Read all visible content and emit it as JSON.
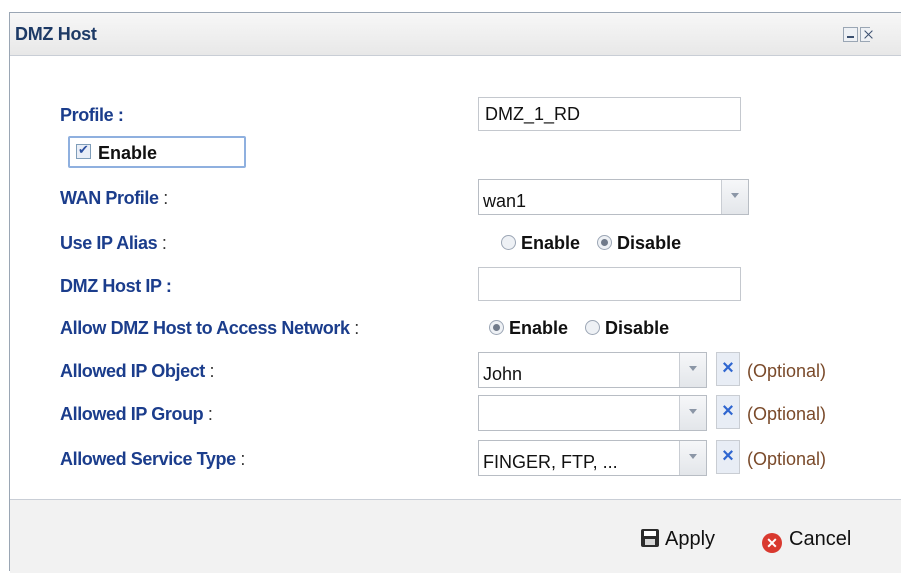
{
  "window": {
    "title": "DMZ Host",
    "minimize_icon": "minimize-icon",
    "close_icon": "close-icon"
  },
  "form": {
    "profile": {
      "label": "Profile :",
      "value": "DMZ_1_RD"
    },
    "enable": {
      "label": "Enable",
      "checked": true
    },
    "wan_profile": {
      "label": "WAN Profile",
      "colon": " :",
      "value": "wan1"
    },
    "use_ip_alias": {
      "label": "Use IP Alias",
      "colon": " :",
      "options": [
        "Enable",
        "Disable"
      ],
      "selected": "Disable"
    },
    "dmz_host_ip": {
      "label": "DMZ Host IP :",
      "value": ""
    },
    "allow_dmz": {
      "label": "Allow DMZ Host to Access Network",
      "colon": " :",
      "options": [
        "Enable",
        "Disable"
      ],
      "selected": "Enable"
    },
    "allowed_ip_object": {
      "label": "Allowed IP Object",
      "colon": " :",
      "value": "John",
      "optional": "(Optional)"
    },
    "allowed_ip_group": {
      "label": "Allowed IP Group",
      "colon": " :",
      "value": "",
      "optional": "(Optional)"
    },
    "allowed_service_type": {
      "label": "Allowed Service Type",
      "colon": " :",
      "value": "FINGER, FTP, ...",
      "optional": "(Optional)"
    }
  },
  "footer": {
    "apply_label": "Apply",
    "cancel_label": "Cancel",
    "apply_icon": "save-icon",
    "cancel_icon": "cancel-icon"
  },
  "colors": {
    "label_blue": "#1b3d8c",
    "optional_brown": "#7a4a2a",
    "cancel_red": "#d9392f"
  }
}
